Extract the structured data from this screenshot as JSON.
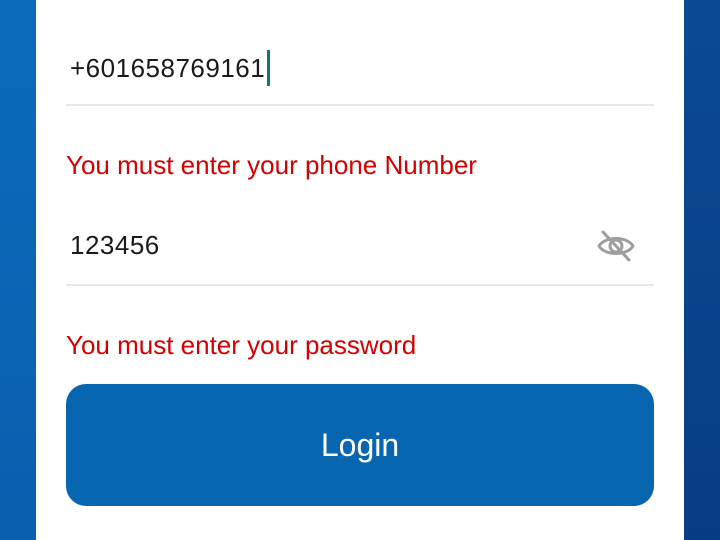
{
  "form": {
    "phone": {
      "value": "+601658769161",
      "error": "You must enter your phone Number"
    },
    "password": {
      "value": "123456",
      "toggle_icon": "eye-off-icon",
      "error": "You must enter your password"
    },
    "login_label": "Login"
  },
  "colors": {
    "accent": "#0866b0",
    "error": "#d50000",
    "cursor": "#0f7a6a",
    "side_left": "#0a5fae",
    "side_right": "#073d86"
  }
}
